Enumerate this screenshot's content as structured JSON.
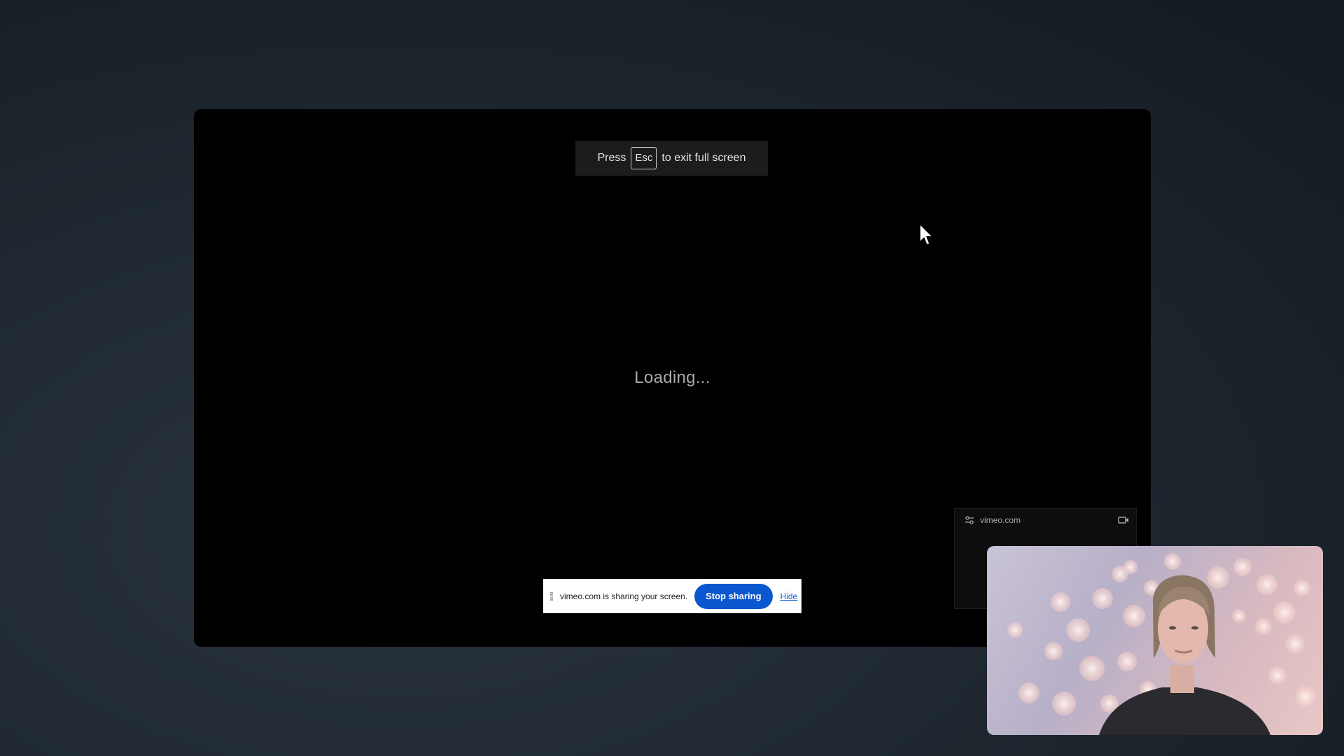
{
  "fullscreen_notice": {
    "press": "Press",
    "key": "Esc",
    "suffix": "to exit full screen"
  },
  "main": {
    "loading_text": "Loading..."
  },
  "share_bar": {
    "message": "vimeo.com is sharing your screen.",
    "stop_label": "Stop sharing",
    "hide_label": "Hide",
    "accent": "#0b57d0"
  },
  "mini_preview": {
    "site": "vimeo.com",
    "icons": [
      "tune-icon",
      "camera-icon"
    ]
  },
  "webcam": {
    "icon": "person-video"
  }
}
